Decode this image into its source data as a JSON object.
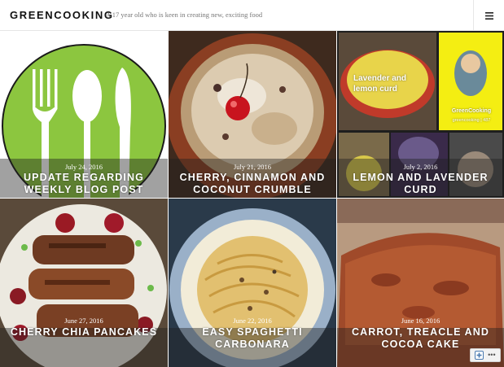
{
  "header": {
    "site_title": "GREENCOOKING",
    "tagline": "A 17 year old who is keen in creating new, exciting food",
    "menu_icon": "hamburger-menu-icon"
  },
  "posts": [
    {
      "date": "July 24, 2016",
      "title": "UPDATE REGARDING WEEKLY BLOG POST"
    },
    {
      "date": "July 21, 2016",
      "title": "CHERRY, CINNAMON AND COCONUT CRUMBLE"
    },
    {
      "date": "July 2, 2016",
      "title": "LEMON AND LAVENDER CURD",
      "image_text": {
        "label": "Lavender and lemon curd",
        "snap_name": "GreenCooking",
        "snap_handle": "greencooking | 487"
      }
    },
    {
      "date": "June 27, 2016",
      "title": "CHERRY CHIA PANCAKES"
    },
    {
      "date": "June 22, 2016",
      "title": "EASY SPAGHETTI CARBONARA"
    },
    {
      "date": "June 16, 2016",
      "title": "CARROT, TREACLE AND COCOA CAKE"
    }
  ],
  "follow_widget": {
    "icon": "follow-plus-icon",
    "more": "•••"
  },
  "colors": {
    "accent_green": "#8cc63f",
    "overlay": "rgba(30,30,30,0.42)"
  }
}
